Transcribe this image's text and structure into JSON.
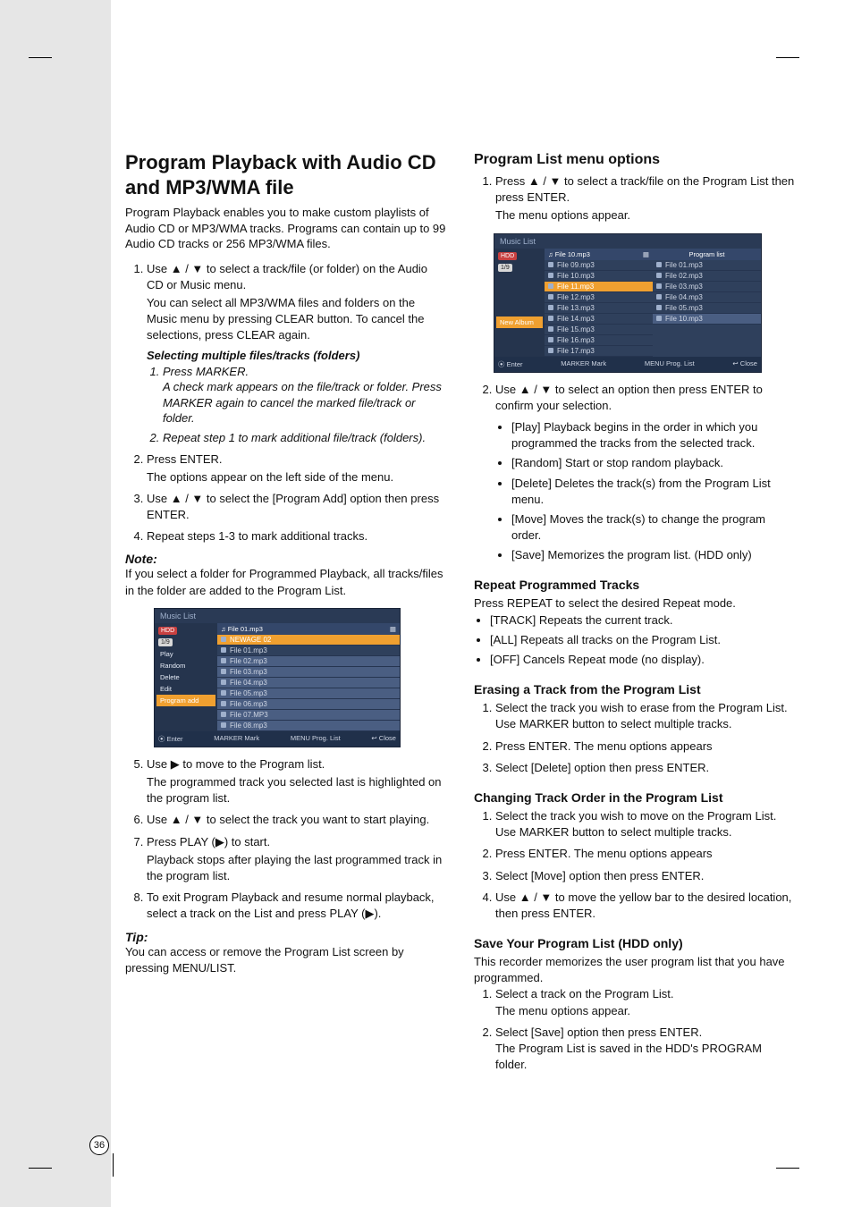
{
  "pageNumber": "36",
  "left": {
    "h1": "Program Playback with Audio CD and MP3/WMA file",
    "intro": "Program Playback enables you to make custom playlists of Audio CD or MP3/WMA tracks. Programs can contain up to 99 Audio CD tracks or 256 MP3/WMA files.",
    "step1a": "Use ▲ / ▼ to select a track/file (or folder) on the Audio CD or Music menu.",
    "step1b": "You can select all MP3/WMA files and folders on the Music menu by pressing CLEAR button. To cancel the selections, press CLEAR again.",
    "subHeading": "Selecting multiple files/tracks (folders)",
    "sub1a": "Press MARKER.",
    "sub1b": "A check mark appears on the file/track or folder. Press MARKER again to cancel the marked file/track or folder.",
    "sub2": "Repeat step 1 to mark additional file/track (folders).",
    "step2a": "Press ENTER.",
    "step2b": "The options appear on the left side of the menu.",
    "step3": "Use ▲ / ▼ to select the [Program Add] option then press ENTER.",
    "step4": "Repeat steps 1-3 to mark additional tracks.",
    "noteH": "Note:",
    "note": "If you select a folder for Programmed Playback, all tracks/files in the folder are added to the Program List.",
    "step5a": "Use ▶ to move to the Program list.",
    "step5b": "The programmed track you selected last is highlighted on the program list.",
    "step6": "Use ▲ / ▼ to select the track you want to start playing.",
    "step7a": "Press PLAY (▶) to start.",
    "step7b": "Playback stops after playing the last programmed track in the program list.",
    "step8": "To exit Program Playback and resume normal playback, select a track on the List and press PLAY (▶).",
    "tipH": "Tip:",
    "tip": "You can access or remove the Program List screen by pressing MENU/LIST.",
    "ss1": {
      "title": "Music List",
      "topCap": "♫ File 01.mp3",
      "side": {
        "pill1": "HDD",
        "pill2": "1/9",
        "items": [
          "Play",
          "Random",
          "Delete",
          "Edit",
          "Program add"
        ]
      },
      "rows": [
        "NEWAGE 02",
        "File 01.mp3",
        "File 02.mp3",
        "File 03.mp3",
        "File 04.mp3",
        "File 05.mp3",
        "File 06.mp3",
        "File 07.MP3",
        "File 08.mp3"
      ],
      "foot": [
        "⦿ Enter",
        "MARKER Mark",
        "MENU Prog. List",
        "↩ Close"
      ]
    }
  },
  "right": {
    "h2": "Program List menu options",
    "r1a": "Press ▲ / ▼ to select a track/file on the Program List then press ENTER.",
    "r1b": "The menu options appear.",
    "r2": "Use ▲ / ▼ to select an option then press ENTER to confirm your selection.",
    "opts": [
      "[Play] Playback begins in the order in which you programmed the tracks from the selected track.",
      "[Random] Start or stop random playback.",
      "[Delete] Deletes the track(s) from the Program List menu.",
      "[Move] Moves the track(s) to change the program order.",
      "[Save] Memorizes the program list. (HDD only)"
    ],
    "repeatH": "Repeat Programmed Tracks",
    "repeatIntro": "Press REPEAT to select the desired Repeat mode.",
    "repeatList": [
      "[TRACK] Repeats the current track.",
      "[ALL] Repeats all tracks on the Program List.",
      "[OFF] Cancels Repeat mode (no display)."
    ],
    "eraseH": "Erasing a Track from the Program List",
    "eraseSteps": [
      "Select the track you wish to erase from the Program List. Use MARKER button to select multiple tracks.",
      "Press ENTER. The menu options appears",
      "Select [Delete] option then press ENTER."
    ],
    "orderH": "Changing Track Order in the Program List",
    "orderSteps": [
      "Select the track you wish to move on the Program List. Use MARKER button to select multiple tracks.",
      "Press ENTER. The menu options appears",
      "Select [Move] option then press ENTER.",
      "Use ▲ / ▼ to move the yellow bar to the desired location, then press ENTER."
    ],
    "saveH": "Save Your Program List (HDD only)",
    "saveIntro": "This recorder memorizes the user program list that you have programmed.",
    "saveSteps": [
      "Select a track on the Program List.\nThe menu options appear.",
      "Select [Save] option then press ENTER.\nThe Program List is saved in the HDD's PROGRAM folder."
    ],
    "ss2": {
      "title": "Music List",
      "topCap": "♫ File 10.mp3",
      "side": {
        "pill1": "HDD",
        "pill2": "1/9",
        "newAlbum": "New Album"
      },
      "leftRows": [
        "File 09.mp3",
        "File 10.mp3",
        "File 11.mp3",
        "File 12.mp3",
        "File 13.mp3",
        "File 14.mp3",
        "File 15.mp3",
        "File 16.mp3",
        "File 17.mp3"
      ],
      "rightHd": "Program list",
      "rightRows": [
        "File 01.mp3",
        "File 02.mp3",
        "File 03.mp3",
        "File 04.mp3",
        "File 05.mp3",
        "File 10.mp3"
      ],
      "foot": [
        "⦿ Enter",
        "MARKER Mark",
        "MENU Prog. List",
        "↩ Close"
      ]
    }
  }
}
